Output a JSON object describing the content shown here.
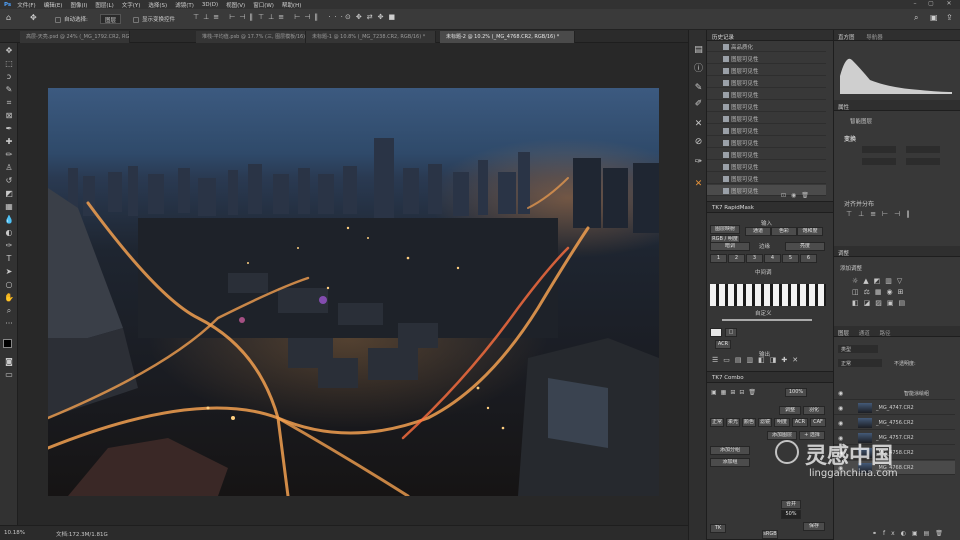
{
  "menu": [
    "文件(F)",
    "编辑(E)",
    "图像(I)",
    "图层(L)",
    "文字(Y)",
    "选择(S)",
    "滤镜(T)",
    "3D(D)",
    "视图(V)",
    "窗口(W)",
    "帮助(H)"
  ],
  "options": {
    "auto_select": "自动选择:",
    "layer_select": "图层",
    "show_transform": "显示变换控件"
  },
  "tabs": [
    {
      "label": "高层-天亮.psd @ 24% (_MG_1792.CR2, RGB/16) *",
      "active": false
    },
    {
      "label": "堆栈-平均值.psb @ 17.7% (三, 图层模板/16) *",
      "active": false
    },
    {
      "label": "未标题-1 @ 10.8% (_MG_7238.CR2, RGB/16) *",
      "active": false
    },
    {
      "label": "未标题-2 @ 10.2% (_MG_4768.CR2, RGB/16) *",
      "active": true
    }
  ],
  "status": {
    "zoom": "10.18%",
    "doc": "文档:172.3M/1.81G"
  },
  "history": {
    "title": "历史记录",
    "items": [
      "高品质化",
      "图层可见性",
      "图层可见性",
      "图层可见性",
      "图层可见性",
      "图层可见性",
      "图层可见性",
      "图层可见性",
      "图层可见性",
      "图层可见性",
      "图层可见性",
      "图层可见性",
      "图层可见性"
    ]
  },
  "rapidmask": {
    "title": "TK7 RapidMask",
    "input": "输入",
    "buttons_row1": [
      "图层映射",
      "通道",
      "色彩",
      "饱和度"
    ],
    "rgb": "RGB / 明度",
    "edge": "边缘",
    "dark": "暗调",
    "bright": "亮度",
    "midtone": "中间调",
    "custom": "自定义",
    "output": "输出",
    "numbers": [
      "1",
      "2",
      "3",
      "4",
      "5",
      "6"
    ],
    "acr": "ACR"
  },
  "combo": {
    "title": "TK7 Combo",
    "zoom": "100%",
    "row1": [
      "调整",
      "羽化"
    ],
    "row2": [
      "正常",
      "柔光",
      "颜色",
      "滤镜"
    ],
    "row3": [
      "明度",
      "ACR",
      "CAF"
    ],
    "row4": [
      "添加图层",
      "+ 选择"
    ],
    "row5": [
      "添加分组",
      "添加组"
    ],
    "opacity": "50%",
    "merge": "合并",
    "save": "保存",
    "srgb": "sRGB",
    "tk": "TK"
  },
  "right": {
    "histogram": "直方图",
    "navigator": "导航器",
    "properties": "属性",
    "property_item": "智能图层",
    "transform": "变换",
    "align": "对齐并分布",
    "adjustments": "调整",
    "add_adjust": "添加调整",
    "layers_tabs": [
      "图层",
      "通道",
      "路径"
    ],
    "kind": "类型",
    "normal": "正常",
    "opacity_label": "不透明度:",
    "group": "智能涂绘组",
    "layers": [
      "_MG_4747.CR2",
      "_MG_4756.CR2",
      "_MG_4757.CR2",
      "_MG_4758.CR2",
      "_MG_4768.CR2"
    ]
  },
  "watermark": {
    "title": "灵感中国",
    "url": "lingganchina.com"
  },
  "colors": {
    "accent_orange": "#e8943a",
    "panel_bg": "#383838",
    "dark_bg": "#282828"
  }
}
